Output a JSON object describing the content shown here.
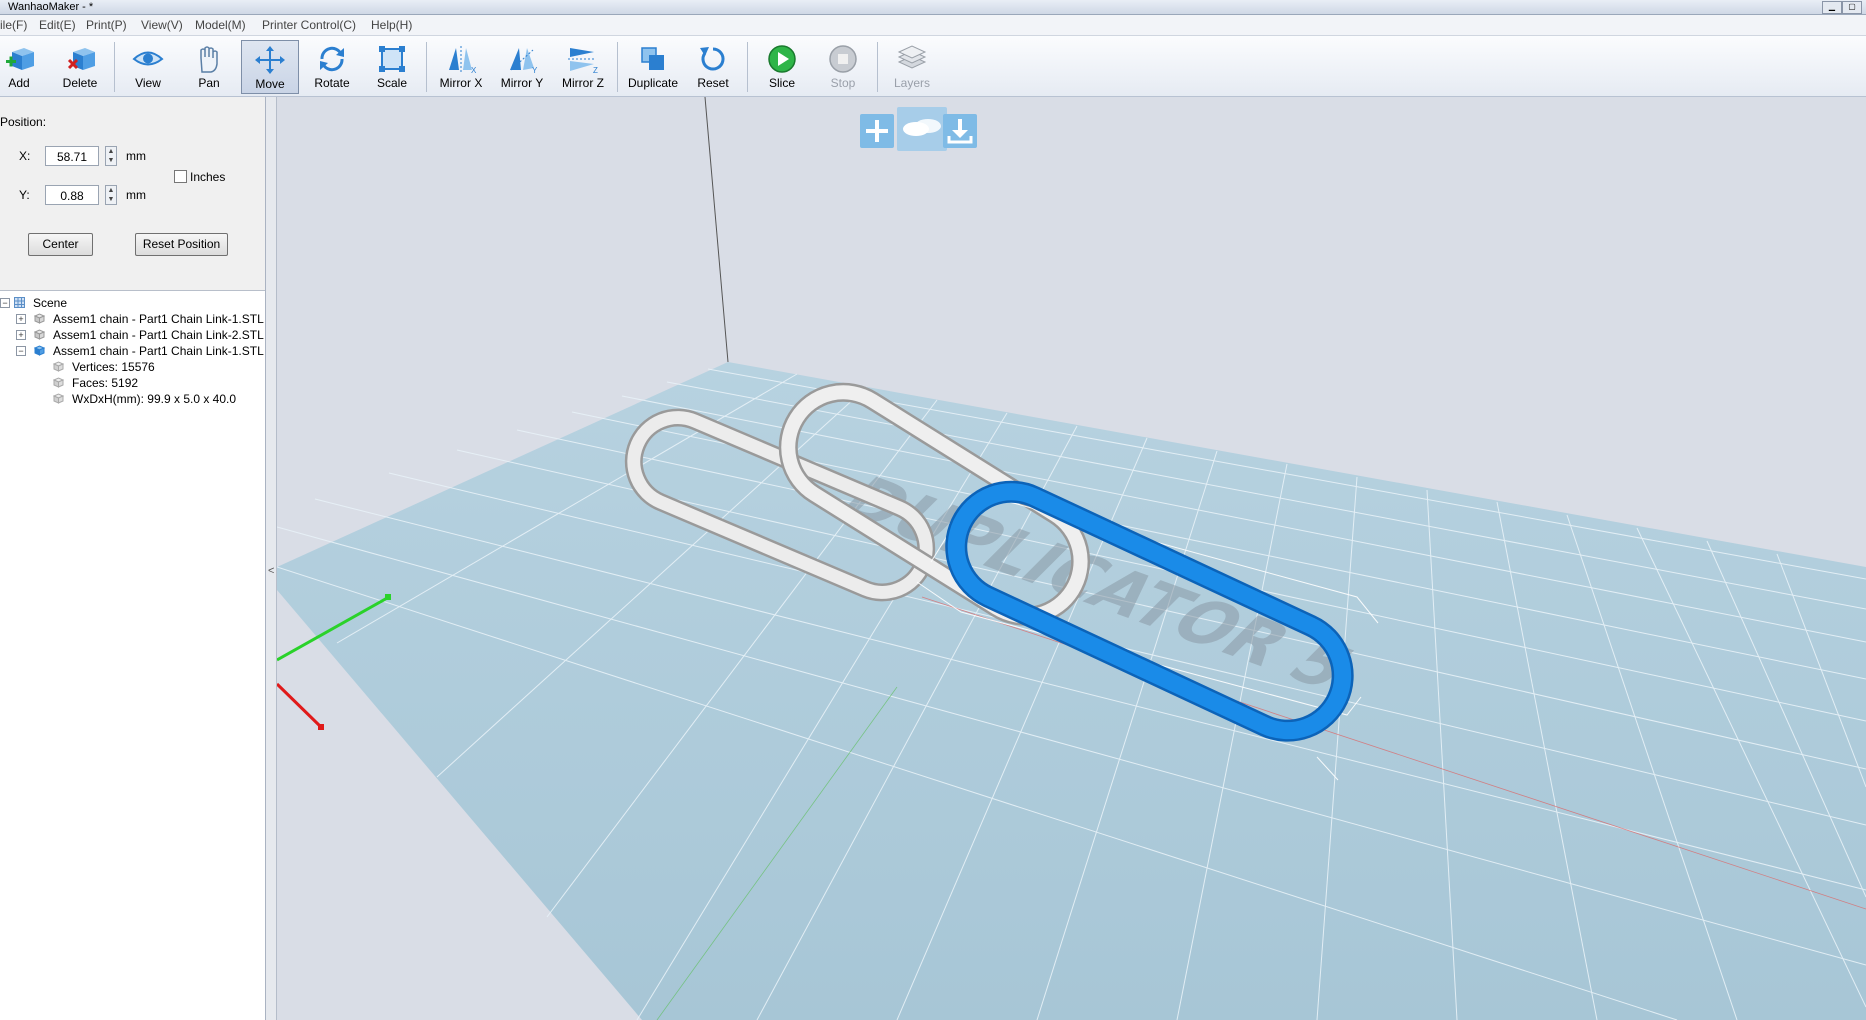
{
  "window": {
    "title": "WanhaoMaker - *"
  },
  "menu": [
    "ile(F)",
    "Edit(E)",
    "Print(P)",
    "View(V)",
    "Model(M)",
    "Printer Control(C)",
    "Help(H)"
  ],
  "toolbar": {
    "add": "Add",
    "delete": "Delete",
    "view": "View",
    "pan": "Pan",
    "move": "Move",
    "rotate": "Rotate",
    "scale": "Scale",
    "mirror_x": "Mirror X",
    "mirror_y": "Mirror Y",
    "mirror_z": "Mirror Z",
    "duplicate": "Duplicate",
    "reset": "Reset",
    "slice": "Slice",
    "stop": "Stop",
    "layers": "Layers"
  },
  "position": {
    "heading": "Position:",
    "x_label": "X:",
    "x_value": "58.71",
    "x_unit": "mm",
    "y_label": "Y:",
    "y_value": "0.88",
    "y_unit": "mm",
    "inches_label": "Inches",
    "inches_checked": false,
    "center_button": "Center",
    "reset_button": "Reset Position"
  },
  "tree": {
    "root": "Scene",
    "items": [
      "Assem1 chain - Part1 Chain Link-1.STL",
      "Assem1 chain - Part1 Chain Link-2.STL",
      "Assem1 chain - Part1 Chain Link-1.STL"
    ],
    "details": [
      "Vertices: 15576",
      "Faces: 5192",
      "WxDxH(mm): 99.9 x 5.0 x 40.0"
    ]
  },
  "viewport": {
    "bed_label": "DUPLICATOR 5",
    "bed_color": "#a8c8d8",
    "selected_color": "#1a8be8",
    "model_color": "#e6e6e6"
  },
  "colors": {
    "accent": "#1a8be8",
    "axis_x": "#e01a1a",
    "axis_y": "#1ad81a"
  }
}
